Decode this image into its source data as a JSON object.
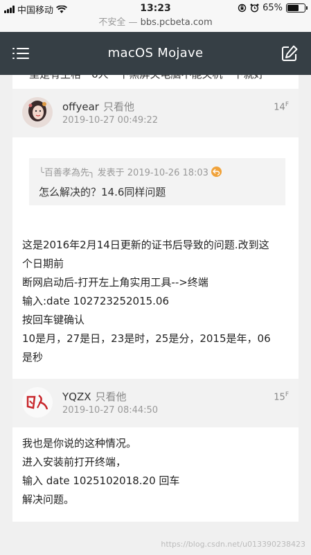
{
  "status_bar": {
    "carrier": "中国移动",
    "time": "13:23",
    "battery": "65%",
    "battery_level": 0.65
  },
  "url_bar": {
    "security": "不安全 —",
    "domain": "bbs.pcbeta.com"
  },
  "header": {
    "title": "macOS Mojave"
  },
  "posts": [
    {
      "username": "offyear",
      "only_him": "只看他",
      "time": "2019-10-27 00:49:22",
      "floor_num": "14",
      "floor_sup": "F",
      "quote": {
        "author": "╰百善孝為先╮",
        "published": "发表于 2019-10-26 18:03",
        "text": "怎么解决的？14.6同样问题"
      },
      "lines": [
        "这是2016年2月14日更新的证书后导致的问题.改到这",
        "个日期前",
        "断网启动后-打开左上角实用工具-->终端",
        "输入:date 102723252015.06",
        "按回车键确认",
        "10是月，27是日，23是时，25是分，2015是年，06",
        "是秒"
      ]
    },
    {
      "username": "YQZX",
      "only_him": "只看他",
      "time": "2019-10-27 08:44:50",
      "floor_num": "15",
      "floor_sup": "F",
      "lines": [
        "我也是你说的这种情况。",
        "进入安装前打开终端，",
        "输入 date 1025102018.20 回车",
        "解决问题。"
      ]
    }
  ],
  "watermark": "https://blog.csdn.net/u013390238423",
  "colors": {
    "header_bg": "#363f45",
    "accent": "#f0a23a"
  }
}
